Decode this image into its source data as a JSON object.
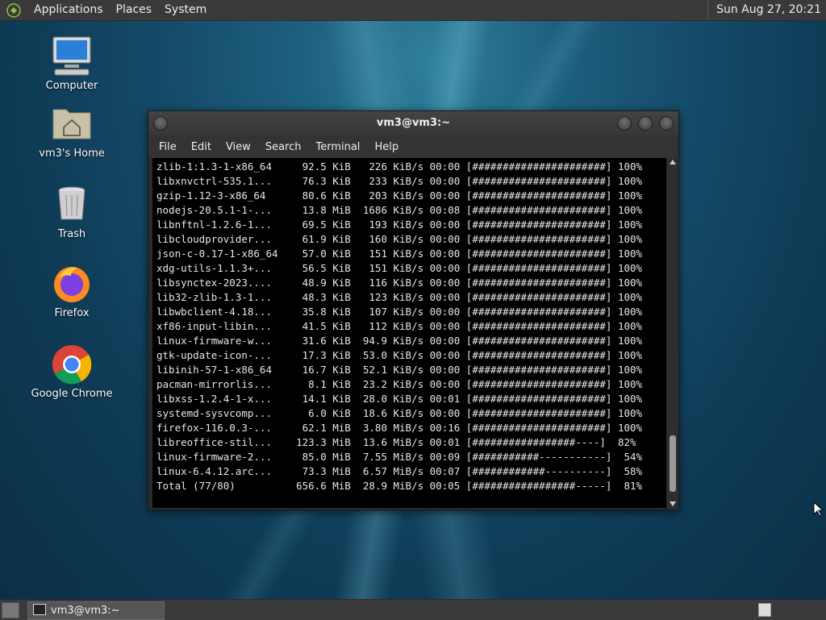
{
  "top_panel": {
    "menus": [
      "Applications",
      "Places",
      "System"
    ],
    "clock": "Sun Aug 27, 20:21"
  },
  "desktop_icons": [
    {
      "label": "Computer",
      "icon": "computer-icon"
    },
    {
      "label": "vm3's Home",
      "icon": "home-folder-icon"
    },
    {
      "label": "Trash",
      "icon": "trash-icon"
    },
    {
      "label": "Firefox",
      "icon": "firefox-icon"
    },
    {
      "label": "Google Chrome",
      "icon": "chrome-icon"
    }
  ],
  "window": {
    "title": "vm3@vm3:~",
    "menus": [
      "File",
      "Edit",
      "View",
      "Search",
      "Terminal",
      "Help"
    ],
    "lines": [
      "zlib-1:1.3-1-x86_64     92.5 KiB   226 KiB/s 00:00 [######################] 100%",
      "libxnvctrl-535.1...     76.3 KiB   233 KiB/s 00:00 [######################] 100%",
      "gzip-1.12-3-x86_64      80.6 KiB   203 KiB/s 00:00 [######################] 100%",
      "nodejs-20.5.1-1-...     13.8 MiB  1686 KiB/s 00:08 [######################] 100%",
      "libnftnl-1.2.6-1...     69.5 KiB   193 KiB/s 00:00 [######################] 100%",
      "libcloudprovider...     61.9 KiB   160 KiB/s 00:00 [######################] 100%",
      "json-c-0.17-1-x86_64    57.0 KiB   151 KiB/s 00:00 [######################] 100%",
      "xdg-utils-1.1.3+...     56.5 KiB   151 KiB/s 00:00 [######################] 100%",
      "libsynctex-2023....     48.9 KiB   116 KiB/s 00:00 [######################] 100%",
      "lib32-zlib-1.3-1...     48.3 KiB   123 KiB/s 00:00 [######################] 100%",
      "libwbclient-4.18...     35.8 KiB   107 KiB/s 00:00 [######################] 100%",
      "xf86-input-libin...     41.5 KiB   112 KiB/s 00:00 [######################] 100%",
      "linux-firmware-w...     31.6 KiB  94.9 KiB/s 00:00 [######################] 100%",
      "gtk-update-icon-...     17.3 KiB  53.0 KiB/s 00:00 [######################] 100%",
      "libinih-57-1-x86_64     16.7 KiB  52.1 KiB/s 00:00 [######################] 100%",
      "pacman-mirrorlis...      8.1 KiB  23.2 KiB/s 00:00 [######################] 100%",
      "libxss-1.2.4-1-x...     14.1 KiB  28.0 KiB/s 00:01 [######################] 100%",
      "systemd-sysvcomp...      6.0 KiB  18.6 KiB/s 00:00 [######################] 100%",
      "firefox-116.0.3-...     62.1 MiB  3.80 MiB/s 00:16 [######################] 100%",
      "libreoffice-stil...    123.3 MiB  13.6 MiB/s 00:01 [#################----]  82%",
      "linux-firmware-2...     85.0 MiB  7.55 MiB/s 00:09 [###########-----------]  54%",
      "linux-6.4.12.arc...     73.3 MiB  6.57 MiB/s 00:07 [############----------]  58%",
      "Total (77/80)          656.6 MiB  28.9 MiB/s 00:05 [#################-----]  81%"
    ]
  },
  "bottom_panel": {
    "task_label": "vm3@vm3:~"
  }
}
